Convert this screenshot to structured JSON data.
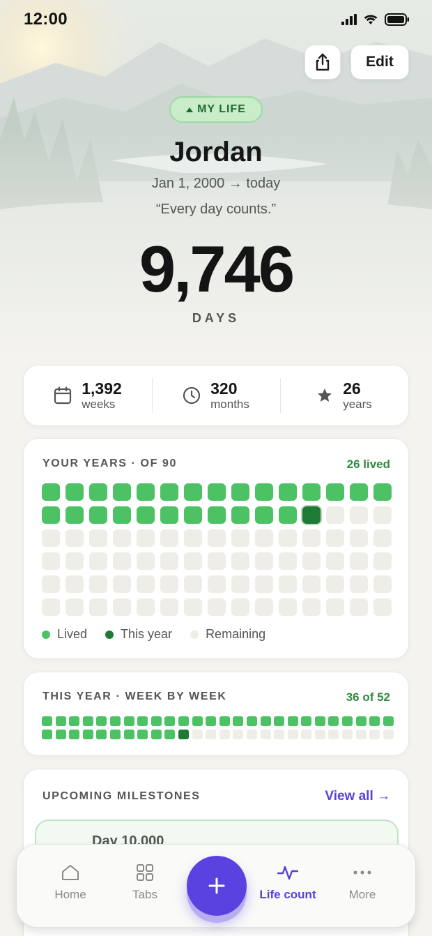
{
  "status_bar": {
    "time": "12:00"
  },
  "header": {
    "edit_label": "Edit",
    "badge": "MY LIFE"
  },
  "profile": {
    "name": "Jordan",
    "date_range": "Jan 1, 2000 → today",
    "quote": "“Every day counts.”",
    "days_count": "9,746",
    "days_label": "DAYS"
  },
  "stats": [
    {
      "icon": "calendar-icon",
      "value": "1,392",
      "unit": "weeks"
    },
    {
      "icon": "clock-icon",
      "value": "320",
      "unit": "months"
    },
    {
      "icon": "star-icon",
      "value": "26",
      "unit": "years"
    }
  ],
  "years_card": {
    "title": "YOUR YEARS · OF 90",
    "summary": "26 lived",
    "total": 90,
    "lived": 26,
    "legend": {
      "lived": "Lived",
      "this_year": "This year",
      "remaining": "Remaining"
    }
  },
  "weeks_card": {
    "title": "THIS YEAR · WEEK BY WEEK",
    "summary": "36 of 52",
    "total": 52,
    "lived": 36
  },
  "milestones_card": {
    "title": "UPCOMING MILESTONES",
    "view_all": "View all →",
    "items": [
      {
        "label": "Day 10,000"
      }
    ]
  },
  "tab_bar": {
    "items": [
      {
        "label": "Home",
        "icon": "home-icon"
      },
      {
        "label": "Tabs",
        "icon": "grid-icon"
      },
      {
        "label": "Life count",
        "icon": "pulse-icon",
        "active": true
      },
      {
        "label": "More",
        "icon": "more-icon"
      }
    ],
    "fab_icon": "plus-icon"
  },
  "colors": {
    "accent": "#5a42e0",
    "lived": "#4cc265",
    "current": "#1f7a35",
    "remaining": "#eeede8",
    "summary_green": "#2e8a3e"
  }
}
